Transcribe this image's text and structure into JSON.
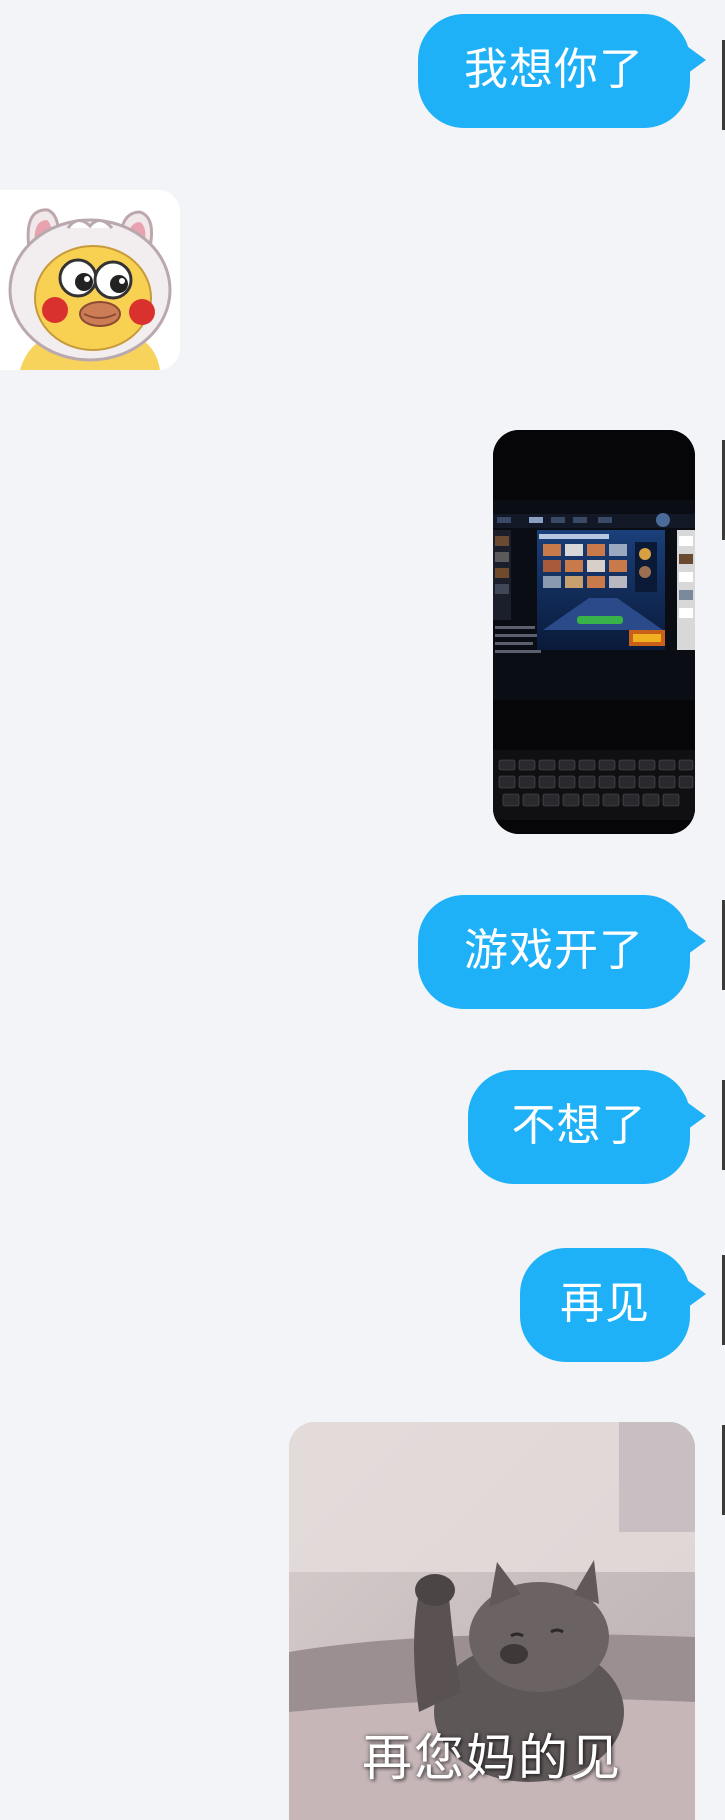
{
  "messages": [
    {
      "type": "text",
      "direction": "out",
      "text": "我想你了"
    },
    {
      "type": "sticker",
      "direction": "in",
      "icon": "chick-bunny-hood-sticker-icon"
    },
    {
      "type": "photo",
      "direction": "out",
      "icon": "laptop-game-photo-icon"
    },
    {
      "type": "text",
      "direction": "out",
      "text": "游戏开了"
    },
    {
      "type": "text",
      "direction": "out",
      "text": "不想了"
    },
    {
      "type": "text",
      "direction": "out",
      "text": "再见"
    },
    {
      "type": "meme",
      "direction": "out",
      "caption": "再您妈的见",
      "icon": "waving-cat-meme-icon"
    }
  ],
  "colors": {
    "background": "#f2f4f8",
    "bubble_out": "#1fb1f8",
    "bubble_text": "#ffffff"
  }
}
